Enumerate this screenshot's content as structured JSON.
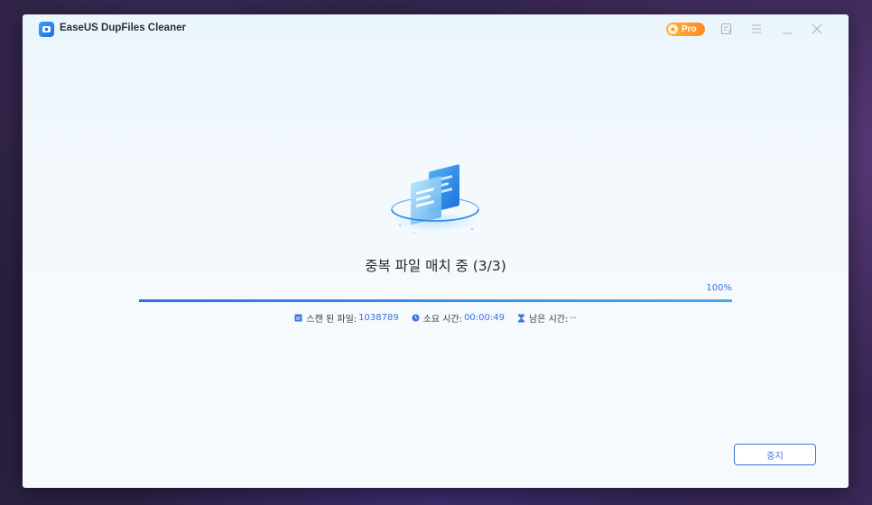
{
  "window": {
    "title": "EaseUS DupFiles Cleaner",
    "pro_badge": "Pro"
  },
  "titlebar_icons": [
    "feedback-icon",
    "menu-icon",
    "minimize-icon",
    "close-icon"
  ],
  "scan": {
    "status": "중복 파일 매치 중 (3/3)",
    "progress_percent": 100,
    "progress_label": "100%",
    "scanned_label": "스캔 된 파일:",
    "scanned_value": "1038789",
    "elapsed_label": "소요 시간:",
    "elapsed_value": "00:00:49",
    "remaining_label": "남은 시간:",
    "remaining_value": "--"
  },
  "actions": {
    "stop_label": "중지"
  },
  "colors": {
    "accent": "#3d74e0",
    "pro_badge": "#ff9a2a",
    "title_text": "#24282f"
  }
}
